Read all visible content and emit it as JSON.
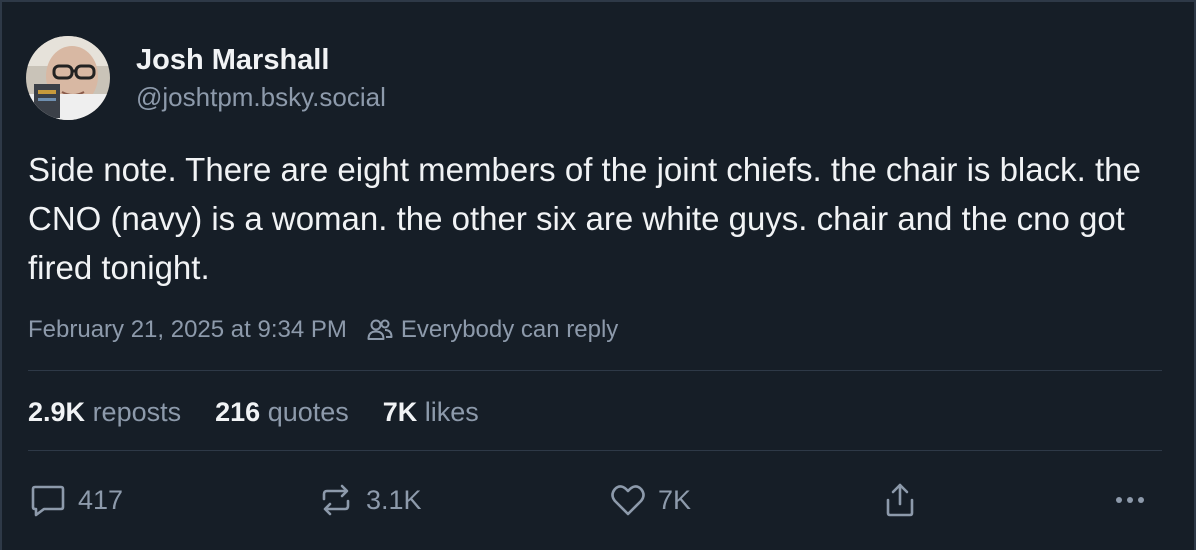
{
  "author": {
    "display_name": "Josh Marshall",
    "handle": "@joshtpm.bsky.social"
  },
  "post": {
    "text": "Side note. There are eight members of the joint chiefs. the chair is black. the CNO (navy) is a woman. the other six are white guys. chair and the cno got fired tonight."
  },
  "meta": {
    "timestamp": "February 21, 2025 at 9:34 PM",
    "reply_setting": "Everybody can reply",
    "reply_setting_icon": "people-icon"
  },
  "counts": {
    "reposts": {
      "value": "2.9K",
      "label": "reposts"
    },
    "quotes": {
      "value": "216",
      "label": "quotes"
    },
    "likes": {
      "value": "7K",
      "label": "likes"
    }
  },
  "actions": {
    "reply": {
      "icon": "comment-icon",
      "count": "417"
    },
    "repost": {
      "icon": "repost-icon",
      "count": "3.1K"
    },
    "like": {
      "icon": "heart-icon",
      "count": "7K"
    },
    "share": {
      "icon": "share-icon"
    },
    "more": {
      "icon": "more-options-icon"
    }
  },
  "colors": {
    "background": "#161e27",
    "text": "#f1f3f5",
    "muted": "#8d9aab",
    "divider": "#2e3947"
  }
}
